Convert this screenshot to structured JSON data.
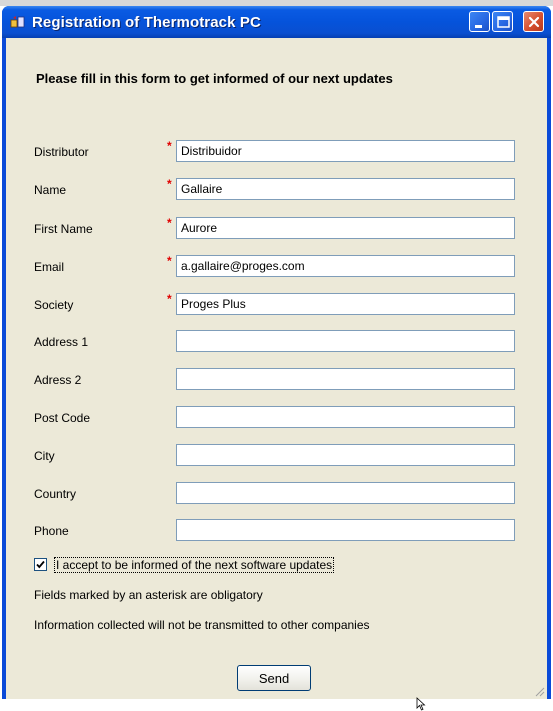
{
  "window": {
    "title": "Registration of Thermotrack PC",
    "controls": [
      "minimize",
      "maximize",
      "close"
    ]
  },
  "form": {
    "header": "Please fill in this form to get informed of our next updates",
    "fields": [
      {
        "label": "Distributor",
        "required": true,
        "value": "Distribuidor"
      },
      {
        "label": "Name",
        "required": true,
        "value": "Gallaire"
      },
      {
        "label": "First Name",
        "required": true,
        "value": "Aurore"
      },
      {
        "label": "Email",
        "required": true,
        "value": "a.gallaire@proges.com"
      },
      {
        "label": "Society",
        "required": true,
        "value": "Proges Plus"
      },
      {
        "label": "Address 1",
        "required": false,
        "value": ""
      },
      {
        "label": "Adress 2",
        "required": false,
        "value": ""
      },
      {
        "label": "Post Code",
        "required": false,
        "value": ""
      },
      {
        "label": "City",
        "required": false,
        "value": ""
      },
      {
        "label": "Country",
        "required": false,
        "value": ""
      },
      {
        "label": "Phone",
        "required": false,
        "value": ""
      }
    ],
    "required_marker": "*",
    "checkbox": {
      "label": "I accept to be informed of the next software updates",
      "checked": true
    },
    "notes": {
      "obligatory": "Fields marked by an asterisk are obligatory",
      "privacy": "Information collected will not be transmitted to other companies"
    },
    "send_label": "Send"
  },
  "colors": {
    "titlebar": "#0553db",
    "client_bg": "#ece9d8",
    "required_star": "#e00000",
    "field_border": "#7f9db9"
  }
}
